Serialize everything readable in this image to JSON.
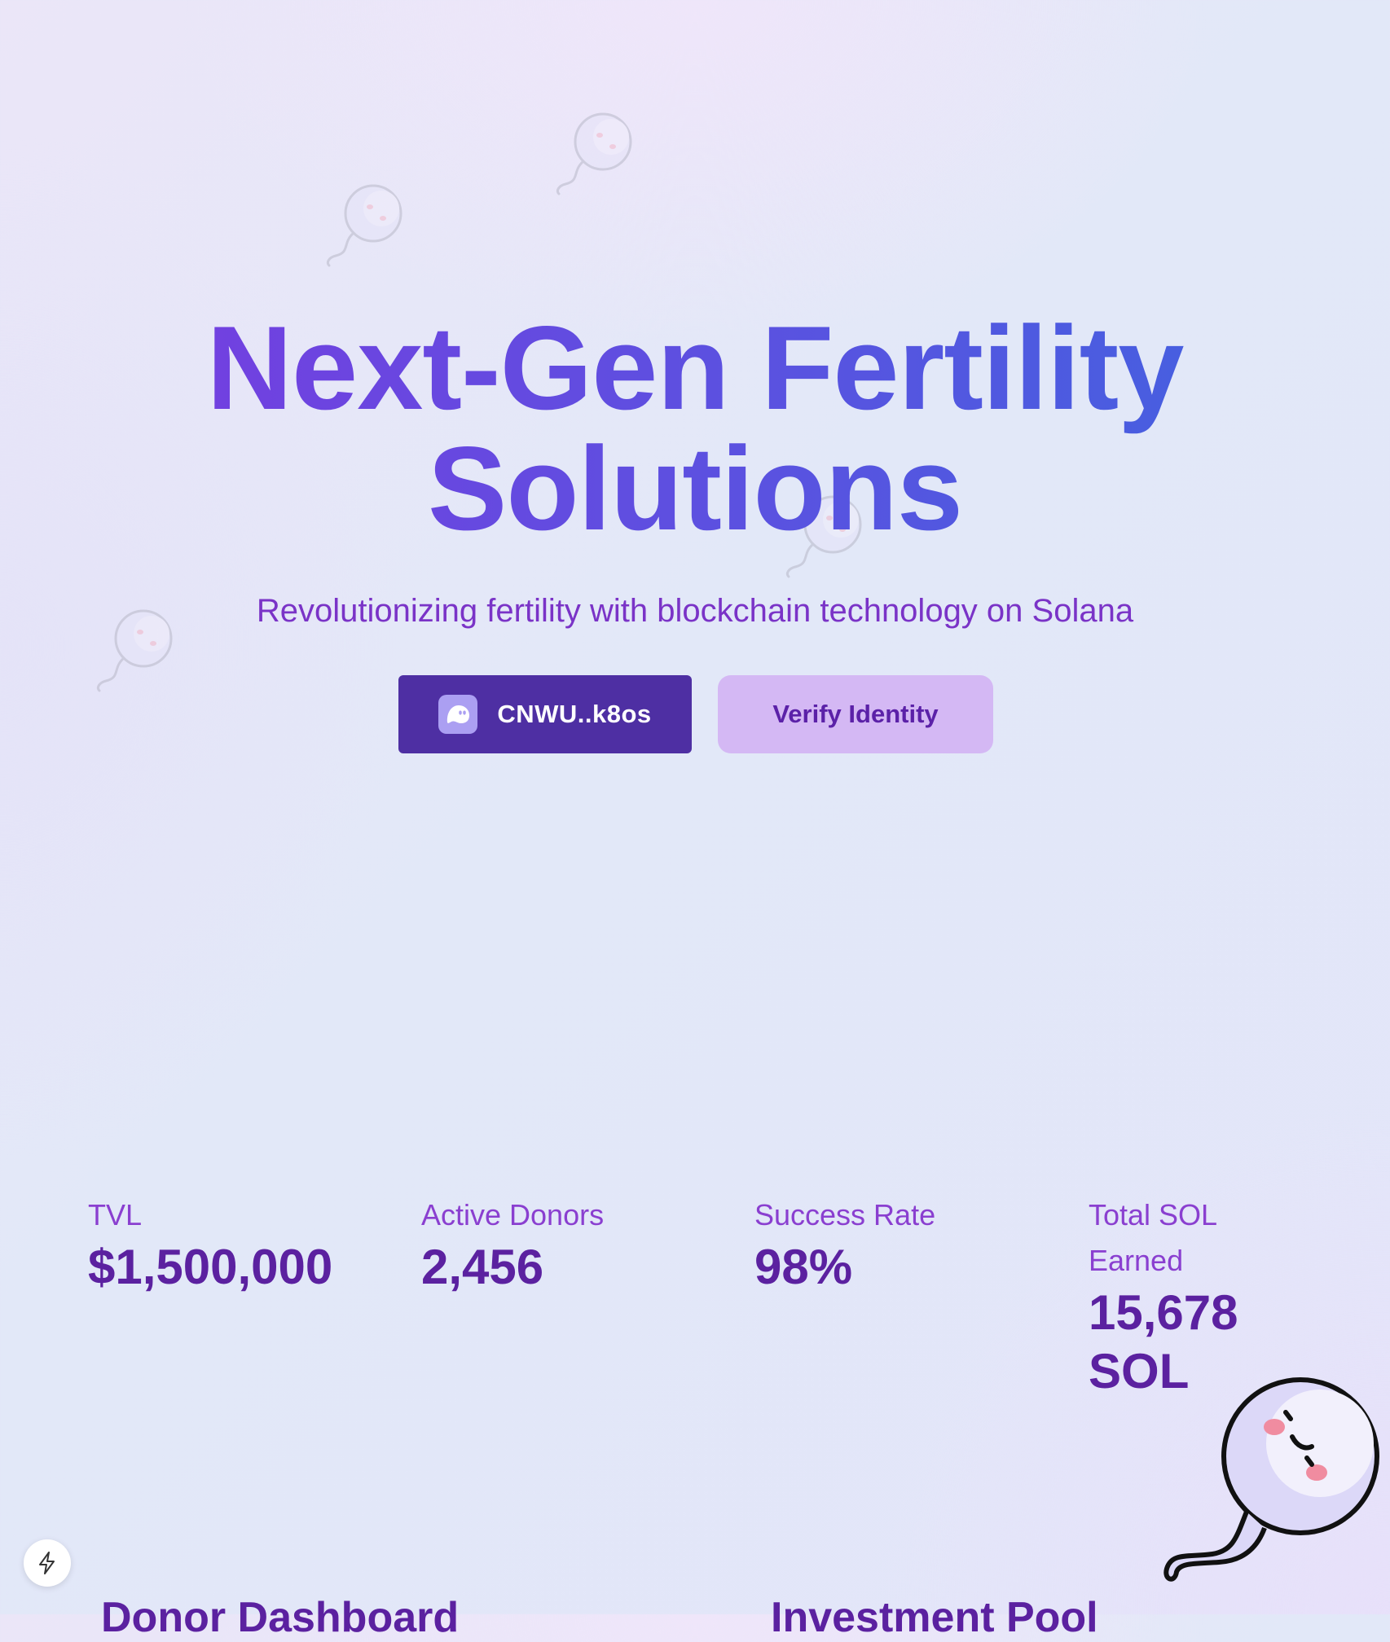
{
  "hero": {
    "title_line1": "Next-Gen Fertility",
    "title_line2": "Solutions",
    "subtitle": "Revolutionizing fertility with blockchain technology on Solana"
  },
  "actions": {
    "wallet_label": "CNWU..k8os",
    "wallet_icon": "phantom-ghost-icon",
    "verify_label": "Verify Identity"
  },
  "stats": [
    {
      "label": "TVL",
      "value": "$1,500,000"
    },
    {
      "label": "Active Donors",
      "value": "2,456"
    },
    {
      "label": "Success Rate",
      "value": "98%"
    },
    {
      "label": "Total SOL Earned",
      "value": "15,678 SOL"
    }
  ],
  "sections": {
    "donor_dashboard": "Donor Dashboard",
    "investment_pool": "Investment Pool"
  },
  "colors": {
    "accent": "#5a52e0",
    "wallet_button": "#4e2fa3",
    "verify_button": "#d4b8f4",
    "text_purple": "#5b21a0"
  },
  "icons": {
    "floating_bolt": "bolt-icon",
    "mascot": "sperm-mascot"
  }
}
